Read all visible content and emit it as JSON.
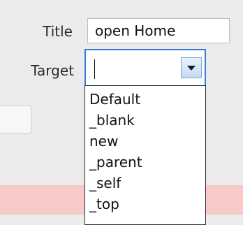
{
  "form": {
    "title_label": "Title",
    "title_value": "open Home",
    "target_label": "Target",
    "target_value": "",
    "target_options": [
      "Default",
      "_blank",
      "new",
      "_parent",
      "_self",
      "_top"
    ]
  },
  "icons": {
    "dropdown": "chevron-down-icon"
  },
  "colors": {
    "focus_border": "#3a79d8",
    "footer_band": "#f7c9c9"
  }
}
